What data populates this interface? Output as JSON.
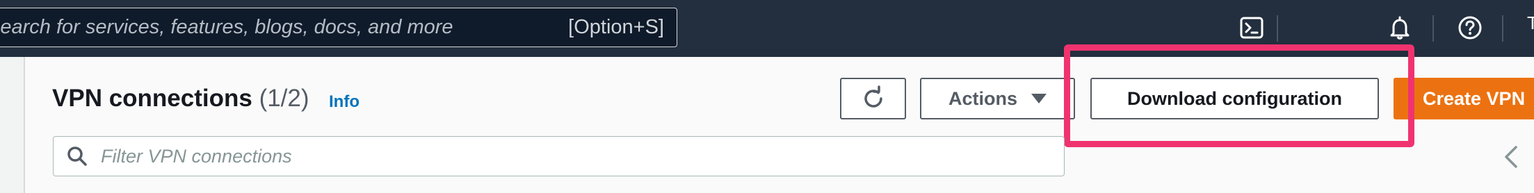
{
  "topbar": {
    "search_placeholder": "Search for services, features, blogs, docs, and more",
    "search_shortcut": "[Option+S]",
    "user_initial": "T",
    "icons": [
      "cloudshell-icon",
      "bell-icon",
      "help-icon"
    ]
  },
  "header": {
    "title": "VPN connections",
    "count": "(1/2)",
    "info_label": "Info"
  },
  "toolbar": {
    "actions_label": "Actions",
    "download_label": "Download configuration",
    "create_label": "Create VPN"
  },
  "filter": {
    "placeholder": "Filter VPN connections"
  },
  "colors": {
    "topbar_bg": "#232f3e",
    "primary_button": "#ec7211",
    "link": "#0073bb",
    "highlight": "#f0336f"
  }
}
